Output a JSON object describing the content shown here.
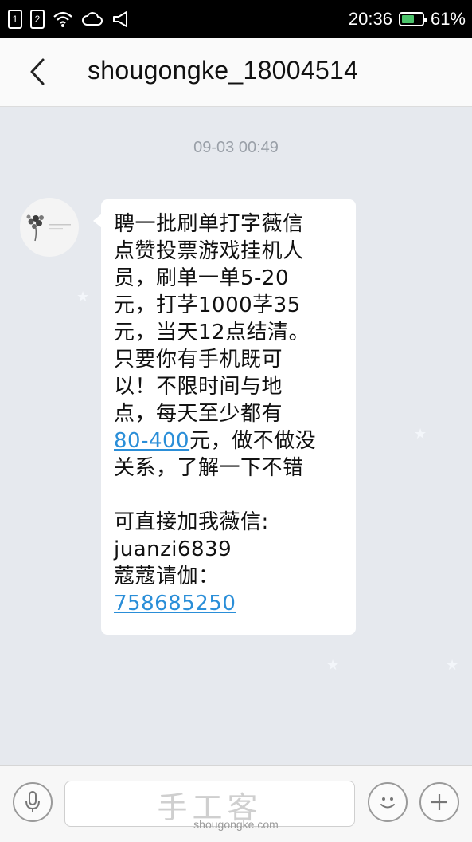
{
  "status_bar": {
    "sim1": "1",
    "sim2": "2",
    "time": "20:36",
    "battery": "61%",
    "battery_level": 0.61,
    "icons": [
      "sim-1-icon",
      "sim-2-icon",
      "wifi-icon",
      "cloud-icon",
      "mute-icon",
      "battery-icon"
    ]
  },
  "header": {
    "title": "shougongke_18004514",
    "back_icon": "chevron-left-icon"
  },
  "chat": {
    "timestamp": "09-03 00:49",
    "message": {
      "part1": "聘一批刷单打字薇信\n点赞投票游戏挂机人\n员，刷单一单5-20\n元，打芓1000芓35\n元，当天12点结清。\n只要你有手机既可\n以！不限时间与地\n点，每天至少都有\n",
      "link1": "80-400",
      "part2": "元，做不做没\n关系，了解一下不错\n\n可直接加我薇信:\njuanzi6839\n蔻蔻请伽：\n",
      "link2": "758685250"
    }
  },
  "input_bar": {
    "voice_icon": "microphone-icon",
    "emoji_icon": "smiley-icon",
    "add_icon": "plus-icon"
  },
  "watermark": {
    "logo": "手工客",
    "url": "shougongke.com"
  },
  "colors": {
    "link": "#2a8ed8",
    "background": "#e6e9ee",
    "battery_fill": "#4cc36b"
  }
}
